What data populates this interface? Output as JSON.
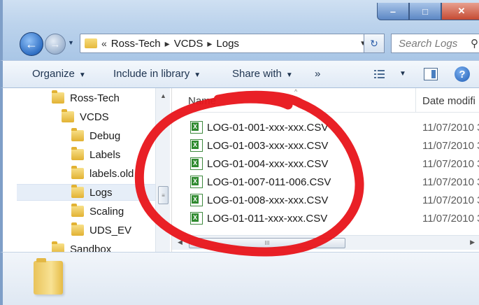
{
  "window": {
    "caption_buttons": {
      "minimize": "‒",
      "maximize": "□",
      "close": "✕"
    }
  },
  "nav": {
    "back_glyph": "←",
    "forward_glyph": "→",
    "dropdown_glyph": "▼"
  },
  "address": {
    "overflow": "«",
    "crumbs": [
      "Ross-Tech",
      "VCDS",
      "Logs"
    ],
    "separator": "▸",
    "dropdown_glyph": "▼",
    "refresh_glyph": "↻"
  },
  "search": {
    "placeholder": "Search Logs",
    "icon": "search-icon",
    "glyph": "⚲"
  },
  "toolbar": {
    "organize": "Organize",
    "include_in_library": "Include in library",
    "share_with": "Share with",
    "more": "»",
    "arrow": "▼",
    "help_glyph": "?"
  },
  "tree": {
    "items": [
      {
        "label": "Ross-Tech"
      },
      {
        "label": "VCDS"
      },
      {
        "label": "Debug"
      },
      {
        "label": "Labels"
      },
      {
        "label": "labels.old"
      },
      {
        "label": "Logs"
      },
      {
        "label": "Scaling"
      },
      {
        "label": "UDS_EV"
      },
      {
        "label": "Sandbox"
      }
    ],
    "selected": "Logs",
    "scroll_up": "▲",
    "thumb_grip": "≡"
  },
  "filelist": {
    "columns": {
      "name": "Name",
      "date": "Date modifi",
      "sort_glyph": "^"
    },
    "files": [
      {
        "name": "LOG-01-001-xxx-xxx.CSV",
        "date": "11/07/2010 3"
      },
      {
        "name": "LOG-01-003-xxx-xxx.CSV",
        "date": "11/07/2010 3"
      },
      {
        "name": "LOG-01-004-xxx-xxx.CSV",
        "date": "11/07/2010 3"
      },
      {
        "name": "LOG-01-007-011-006.CSV",
        "date": "11/07/2010 3"
      },
      {
        "name": "LOG-01-008-xxx-xxx.CSV",
        "date": "11/07/2010 3"
      },
      {
        "name": "LOG-01-011-xxx-xxx.CSV",
        "date": "11/07/2010 3"
      }
    ],
    "hscroll": {
      "left": "◀",
      "right": "▶",
      "grip": "III"
    }
  },
  "annotation": {
    "color": "#e8141a",
    "shape": "hand-drawn circle around file list"
  }
}
